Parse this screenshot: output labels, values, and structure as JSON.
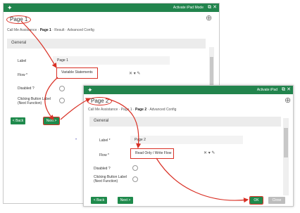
{
  "window1": {
    "title_icon": "pin-icon",
    "title_right": "Activate iPad Mode",
    "page_heading": "Page 1",
    "breadcrumb": [
      "Call Me Assistance",
      "Page 1",
      "Result",
      "Advanced Config"
    ],
    "section": "General",
    "fields": [
      {
        "label": "Label",
        "value": "Page 1"
      },
      {
        "label": "Flow *",
        "value": "Variable Statements"
      },
      {
        "label": "Disabled ?",
        "value": ""
      },
      {
        "label": "Clicking Button Label (Next Function)",
        "value": ""
      }
    ],
    "buttons": {
      "cancel": "< Back",
      "next": "Next >"
    }
  },
  "window2": {
    "title_icon": "pin-icon",
    "title_right": "Activate iPad",
    "page_heading": "Page 2",
    "breadcrumb": [
      "Call Me Assistance",
      "Page 1",
      "Page 2",
      "Advanced Config"
    ],
    "section": "General",
    "fields": [
      {
        "label": "Label *",
        "value": "Page 2"
      },
      {
        "label": "Flow *",
        "value": "Read Only / Write Flow"
      },
      {
        "label": "Disabled ?",
        "value": ""
      },
      {
        "label": "Clicking Button Label (Next Function)",
        "value": ""
      }
    ],
    "buttons": {
      "back": "< Back",
      "next": "Next >",
      "ok": "OK",
      "close": "Close"
    }
  },
  "colors": {
    "accent": "#22844d",
    "highlight": "#d93025"
  }
}
